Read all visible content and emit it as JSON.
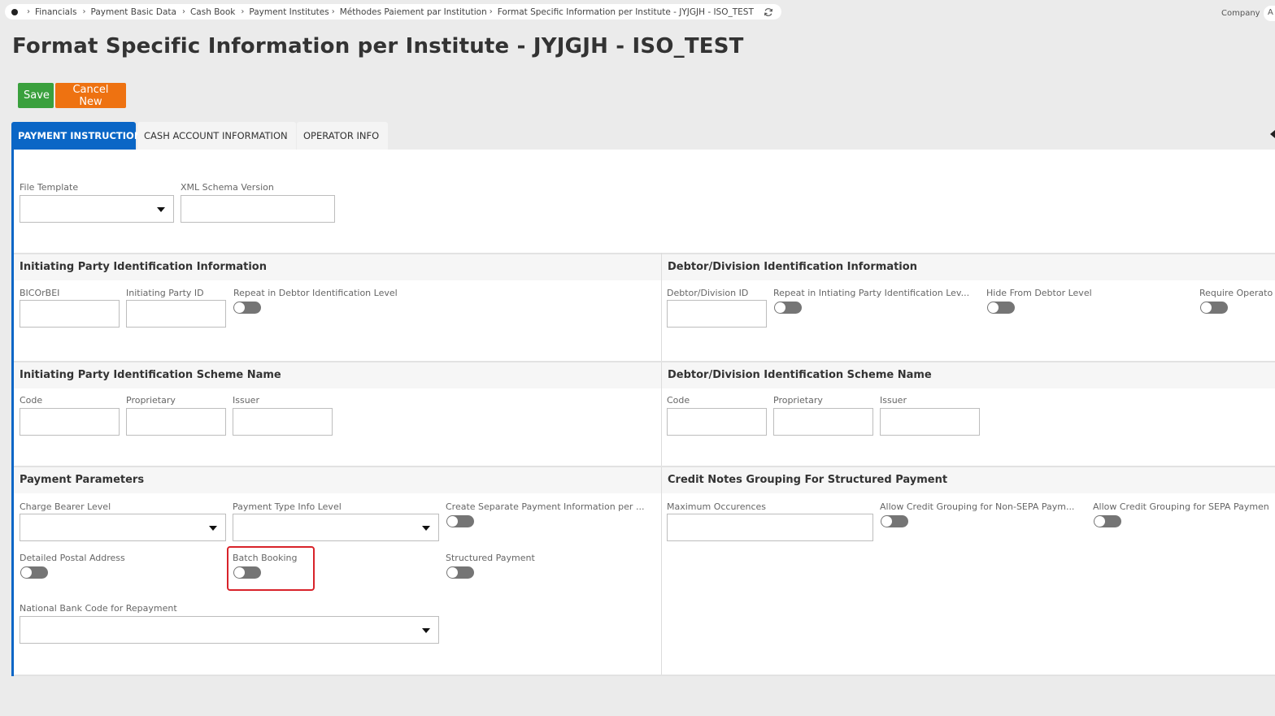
{
  "breadcrumb": {
    "items": [
      "Financials",
      "Payment Basic Data",
      "Cash Book",
      "Payment Institutes",
      "Méthodes Paiement par Institution",
      "Format Specific Information per Institute - JYJGJH - ISO_TEST"
    ]
  },
  "header": {
    "company_label": "Company",
    "company_value": "A"
  },
  "page": {
    "title": "Format Specific Information per Institute - JYJGJH - ISO_TEST"
  },
  "toolbar": {
    "save_label": "Save",
    "cancel_label": "Cancel New"
  },
  "tabs": [
    {
      "label": "PAYMENT INSTRUCTION",
      "active": true
    },
    {
      "label": "CASH ACCOUNT INFORMATION",
      "active": false
    },
    {
      "label": "OPERATOR INFO",
      "active": false
    }
  ],
  "general": {
    "file_template_label": "File Template",
    "file_template_value": "",
    "xml_schema_label": "XML Schema Version",
    "xml_schema_value": ""
  },
  "initiating_party": {
    "title": "Initiating Party Identification Information",
    "bic_label": "BICOrBEI",
    "id_label": "Initiating Party ID",
    "repeat_label": "Repeat in Debtor Identification Level"
  },
  "debtor": {
    "title": "Debtor/Division Identification Information",
    "id_label": "Debtor/Division ID",
    "repeat_label": "Repeat in Intiating Party Identification Lev...",
    "hide_label": "Hide From Debtor Level",
    "require_label": "Require Operato"
  },
  "initiating_scheme": {
    "title": "Initiating Party Identification Scheme Name",
    "code_label": "Code",
    "proprietary_label": "Proprietary",
    "issuer_label": "Issuer"
  },
  "debtor_scheme": {
    "title": "Debtor/Division Identification Scheme Name",
    "code_label": "Code",
    "proprietary_label": "Proprietary",
    "issuer_label": "Issuer"
  },
  "payment_params": {
    "title": "Payment Parameters",
    "charge_bearer_label": "Charge Bearer Level",
    "payment_type_label": "Payment Type Info Level",
    "create_separate_label": "Create Separate Payment Information per ...",
    "detailed_postal_label": "Detailed Postal Address",
    "batch_booking_label": "Batch Booking",
    "structured_payment_label": "Structured Payment",
    "national_bank_label": "National Bank Code for Repayment"
  },
  "credit_notes": {
    "title": "Credit Notes Grouping For Structured Payment",
    "max_occ_label": "Maximum Occurences",
    "non_sepa_label": "Allow Credit Grouping for Non-SEPA Paym...",
    "sepa_label": "Allow Credit Grouping for SEPA Paymen"
  }
}
